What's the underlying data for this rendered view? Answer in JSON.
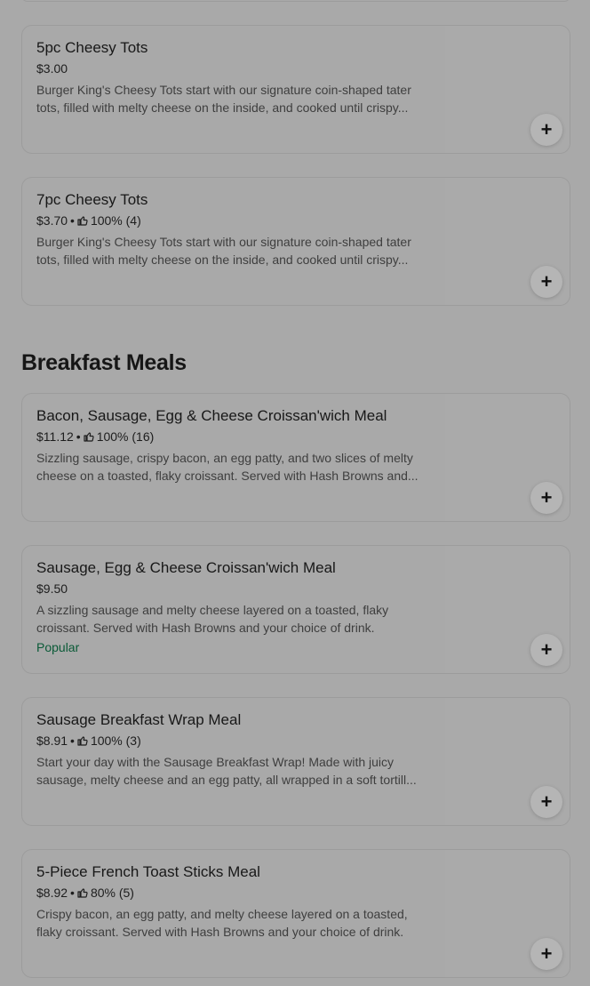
{
  "sections": [
    {
      "title": "",
      "items": [
        {
          "name": "5pc Cheesy Tots",
          "price": "$3.00",
          "rating": "",
          "description": "Burger King's Cheesy Tots start with our signature coin-shaped tater tots, filled with melty cheese on the inside, and cooked until crispy...",
          "badge": ""
        },
        {
          "name": "7pc Cheesy Tots",
          "price": "$3.70",
          "rating": "100% (4)",
          "description": "Burger King's Cheesy Tots start with our signature coin-shaped tater tots, filled with melty cheese on the inside, and cooked until crispy...",
          "badge": ""
        }
      ]
    },
    {
      "title": "Breakfast Meals",
      "items": [
        {
          "name": "Bacon, Sausage, Egg & Cheese Croissan'wich Meal",
          "price": "$11.12",
          "rating": "100% (16)",
          "description": "Sizzling sausage, crispy bacon, an egg patty, and two slices of melty cheese on a toasted, flaky croissant. Served with Hash Browns and...",
          "badge": ""
        },
        {
          "name": "Sausage, Egg & Cheese Croissan'wich Meal",
          "price": "$9.50",
          "rating": "",
          "description": "A sizzling sausage and melty cheese layered on a toasted, flaky croissant. Served with Hash Browns and your choice of drink.",
          "badge": "Popular"
        },
        {
          "name": "Sausage Breakfast Wrap Meal",
          "price": "$8.91",
          "rating": "100% (3)",
          "description": "Start your day with the Sausage Breakfast Wrap! Made with juicy sausage, melty cheese and an egg patty, all wrapped in a soft tortill...",
          "badge": ""
        },
        {
          "name": "5-Piece French Toast Sticks Meal",
          "price": "$8.92",
          "rating": "80% (5)",
          "description": "Crispy bacon, an egg patty, and melty cheese layered on a toasted, flaky croissant. Served with Hash Browns and your choice of drink.",
          "badge": ""
        }
      ]
    }
  ],
  "icons": {
    "add": "plus-icon",
    "rating": "thumbs-up-icon"
  },
  "colors": {
    "overlay_background": "#a9a9a9",
    "popular_badge": "#0a5a37"
  }
}
